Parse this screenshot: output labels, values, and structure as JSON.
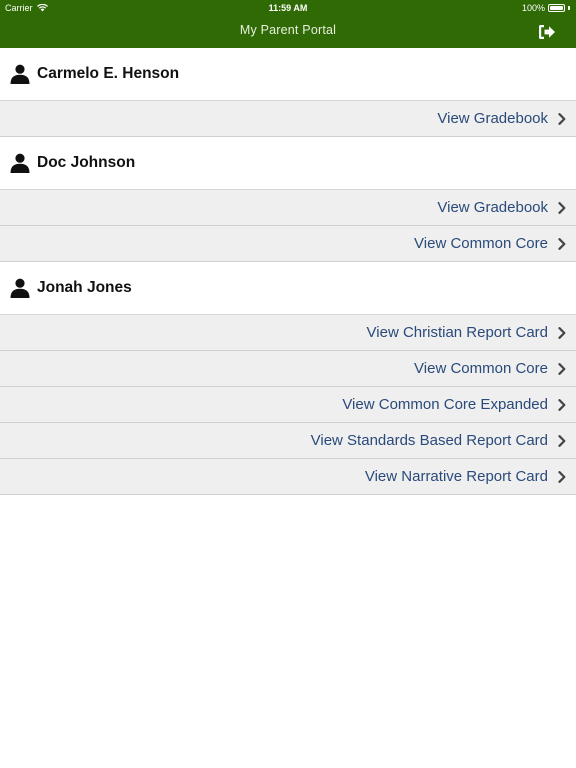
{
  "status_bar": {
    "carrier": "Carrier",
    "time": "11:59 AM",
    "battery": "100%",
    "battery_level": 1.0
  },
  "nav": {
    "title": "My Parent Portal",
    "logout_icon": "logout-icon",
    "bar_color": "#2f6a04"
  },
  "students": [
    {
      "name": "Carmelo E. Henson",
      "links": [
        {
          "label": "View Gradebook"
        }
      ]
    },
    {
      "name": "Doc Johnson",
      "links": [
        {
          "label": "View Gradebook"
        },
        {
          "label": "View Common Core"
        }
      ]
    },
    {
      "name": "Jonah Jones",
      "links": [
        {
          "label": "View Christian Report Card"
        },
        {
          "label": "View Common Core"
        },
        {
          "label": "View Common Core Expanded"
        },
        {
          "label": "View Standards Based Report Card"
        },
        {
          "label": "View Narrative Report Card"
        }
      ]
    }
  ],
  "colors": {
    "link_text": "#2a4a7a",
    "row_bg": "#efefef"
  }
}
